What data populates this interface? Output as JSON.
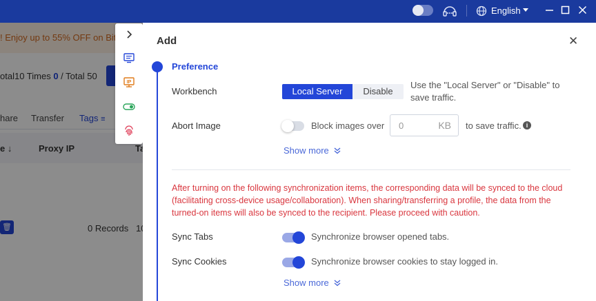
{
  "topbar": {
    "language": "English"
  },
  "background": {
    "promo_text": "! Enjoy up to 55% OFF on BitB",
    "stats_prefix": "otal10  Times ",
    "stats_count": "0",
    "stats_suffix": " / Total 50",
    "tabs": [
      "hare",
      "Transfer",
      "Tags"
    ],
    "headers": [
      "e ↓",
      "Proxy IP",
      "Ta"
    ],
    "records": "0 Records",
    "records_extra": "10"
  },
  "colors": {
    "accent": "#2346d8",
    "warning": "#d9363e",
    "promo": "#d2691e"
  },
  "modal": {
    "title": "Add",
    "close_glyph": "✕",
    "section": "Preference",
    "workbench": {
      "label": "Workbench",
      "options": [
        "Local Server",
        "Disable"
      ],
      "selected": "Local Server",
      "hint_line1": "Use the \"Local Server\" or \"Disable\" to",
      "hint_line2": "save traffic."
    },
    "abort_image": {
      "label": "Abort Image",
      "enabled": false,
      "prefix": "Block images over",
      "placeholder": "0",
      "unit": "KB",
      "suffix": "to save traffic."
    },
    "show_more": "Show more",
    "warning": "After turning on the following synchronization items, the corresponding data will be synced to the cloud (facilitating cross-device usage/collaboration). When sharing/transferring a profile, the data from the turned-on items will also be synced to the recipient. Please proceed with caution.",
    "sync_tabs": {
      "label": "Sync Tabs",
      "enabled": true,
      "desc": "Synchronize browser opened tabs."
    },
    "sync_cookies": {
      "label": "Sync Cookies",
      "enabled": true,
      "desc": "Synchronize browser cookies to stay logged in."
    }
  }
}
